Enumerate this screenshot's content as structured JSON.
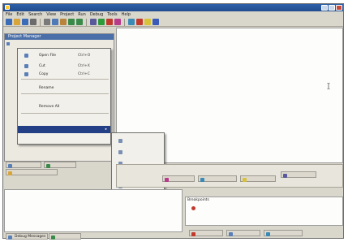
{
  "window": {
    "title": ""
  },
  "menubar": {
    "items": [
      "File",
      "Edit",
      "Search",
      "View",
      "Project",
      "Run",
      "Debug",
      "Tools",
      "Help"
    ]
  },
  "toolbar": {
    "buttons": [
      {
        "icon": "new-file-icon",
        "color": "#3b6cb8"
      },
      {
        "icon": "open-folder-icon",
        "color": "#d8a53a"
      },
      {
        "icon": "save-icon",
        "color": "#3b6cb8"
      },
      {
        "icon": "print-icon",
        "color": "#6b6b6b"
      },
      {
        "icon": "cut-icon",
        "color": "#7a7a7a"
      },
      {
        "icon": "copy-icon",
        "color": "#4f7ab8"
      },
      {
        "icon": "paste-icon",
        "color": "#b8843b"
      },
      {
        "icon": "undo-icon",
        "color": "#3a8a4a"
      },
      {
        "icon": "redo-icon",
        "color": "#3a8a4a"
      },
      {
        "icon": "find-icon",
        "color": "#5a5a9a"
      },
      {
        "icon": "run-icon",
        "color": "#2d9a3c"
      },
      {
        "icon": "stop-icon",
        "color": "#c23a2e"
      },
      {
        "icon": "debug-icon",
        "color": "#b83a8a"
      },
      {
        "icon": "step-icon",
        "color": "#3a8ab8"
      },
      {
        "icon": "breakpoint-icon",
        "color": "#c23a2e"
      },
      {
        "icon": "tool-icon",
        "color": "#d8c23a"
      },
      {
        "icon": "help-icon",
        "color": "#3a5ab8"
      }
    ]
  },
  "left_pane": {
    "header": "Project Manager",
    "tree": [
      "",
      ""
    ]
  },
  "context_menu": {
    "items": [
      {
        "label": "Open File",
        "key": "Ctrl+O"
      },
      {
        "label": "Cut",
        "key": "Ctrl+X"
      },
      {
        "label": "Copy",
        "key": "Ctrl+C"
      },
      {
        "label": "Rename",
        "key": ""
      },
      {
        "label": "",
        "key": ""
      },
      {
        "label": "Remove All",
        "key": ""
      },
      {
        "label": "",
        "key": ""
      },
      {
        "label": "",
        "key": ""
      }
    ]
  },
  "submenu": {
    "items": [
      "",
      "",
      "",
      "",
      ""
    ]
  },
  "editor": {
    "lines": [
      "",
      "",
      "",
      "",
      "",
      "",
      "",
      "",
      "",
      "",
      "",
      "",
      "",
      "",
      "",
      "",
      "",
      "",
      "",
      ""
    ]
  },
  "bottom_tabs": {
    "left": [
      "",
      "",
      ""
    ],
    "lower": [
      "Debug Messages",
      ""
    ],
    "lower_right": [
      "",
      "",
      ""
    ]
  },
  "lower_left": {
    "lines": [
      "",
      "",
      ""
    ]
  },
  "lower_right": {
    "header": "Breakpoints",
    "lines": [
      ""
    ]
  }
}
